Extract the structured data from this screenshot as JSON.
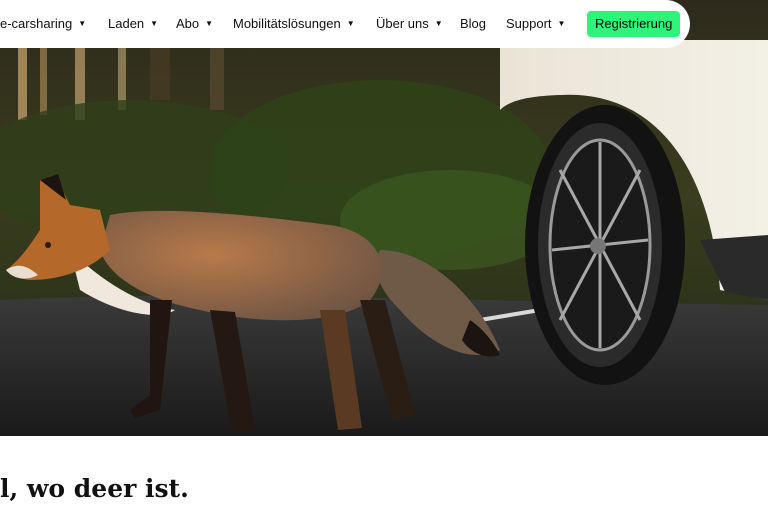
{
  "nav": {
    "items": [
      {
        "label": "e-carsharing",
        "caret": true
      },
      {
        "label": "Laden",
        "caret": true
      },
      {
        "label": "Abo",
        "caret": true
      },
      {
        "label": "Mobilitätslösungen",
        "caret": true
      },
      {
        "label": "Über uns",
        "caret": true
      },
      {
        "label": "Blog",
        "caret": false
      },
      {
        "label": "Support",
        "caret": true
      }
    ],
    "cta_label": "Registrierung",
    "cta_color": "#2ef57a",
    "caret_icon": "chevron-down-icon"
  },
  "hero": {
    "image": "fox-crossing-road-next-to-white-car-wheel"
  },
  "headline": {
    "text": "l, wo deer ist."
  }
}
